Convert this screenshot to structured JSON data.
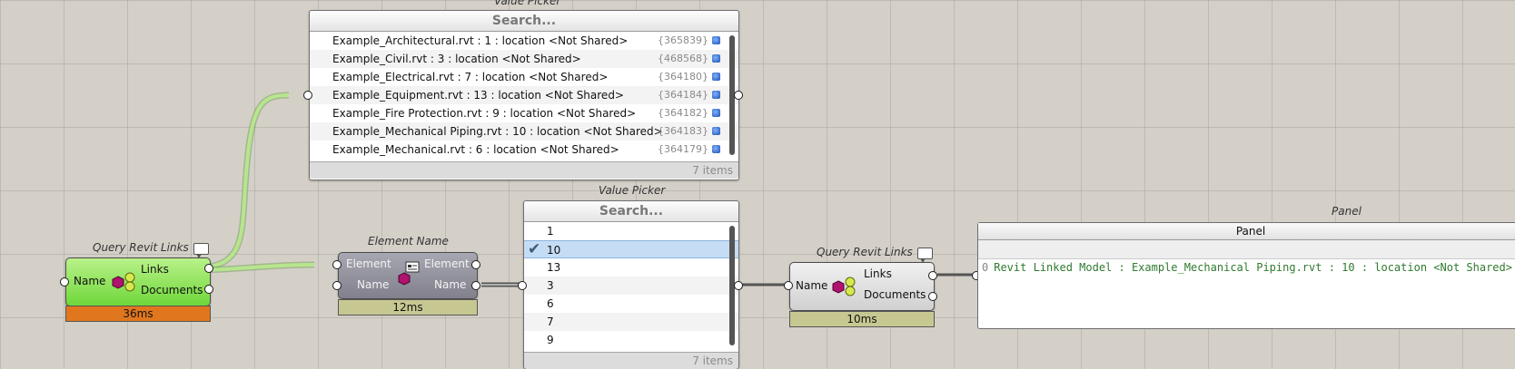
{
  "value_picker_top": {
    "title": "Value Picker",
    "search": "Search...",
    "items": [
      {
        "label": "Example_Architectural.rvt : 1 : location <Not Shared>",
        "id": "{365839}"
      },
      {
        "label": "Example_Civil.rvt : 3 : location <Not Shared>",
        "id": "{468568}"
      },
      {
        "label": "Example_Electrical.rvt : 7 : location <Not Shared>",
        "id": "{364180}"
      },
      {
        "label": "Example_Equipment.rvt : 13 : location <Not Shared>",
        "id": "{364184}"
      },
      {
        "label": "Example_Fire Protection.rvt : 9 : location <Not Shared>",
        "id": "{364182}"
      },
      {
        "label": "Example_Mechanical Piping.rvt : 10 : location <Not Shared>",
        "id": "{364183}"
      },
      {
        "label": "Example_Mechanical.rvt : 6 : location <Not Shared>",
        "id": "{364179}"
      }
    ],
    "count": "7 items"
  },
  "value_picker_mid": {
    "title": "Value Picker",
    "search": "Search...",
    "items": [
      "1",
      "10",
      "13",
      "3",
      "6",
      "7",
      "9"
    ],
    "selected": "10",
    "count": "7 items"
  },
  "query_left": {
    "title": "Query Revit Links",
    "input": "Name",
    "outputs": [
      "Links",
      "Documents"
    ],
    "timer": "36ms"
  },
  "element_name": {
    "title": "Element Name",
    "inputs": [
      "Element",
      "Name"
    ],
    "outputs": [
      "Element",
      "Name"
    ],
    "timer": "12ms"
  },
  "query_right": {
    "title": "Query Revit Links",
    "input": "Name",
    "outputs": [
      "Links",
      "Documents"
    ],
    "timer": "10ms"
  },
  "panel": {
    "title": "Panel",
    "header": "Panel",
    "line_index": "0",
    "line_text": "Revit Linked Model : Example_Mechanical Piping.rvt : 10 : location <Not Shared>"
  },
  "colors": {
    "canvas": "#d4d0c8",
    "green_component": "#8be04f",
    "orange_timer": "#e0761e",
    "olive_timer": "#c7c792",
    "selection": "#c5dcf5"
  },
  "icons": [
    "revit-links-icon",
    "element-name-icon",
    "check-icon",
    "revit-element-cube-icon",
    "comment-bubble-icon"
  ]
}
